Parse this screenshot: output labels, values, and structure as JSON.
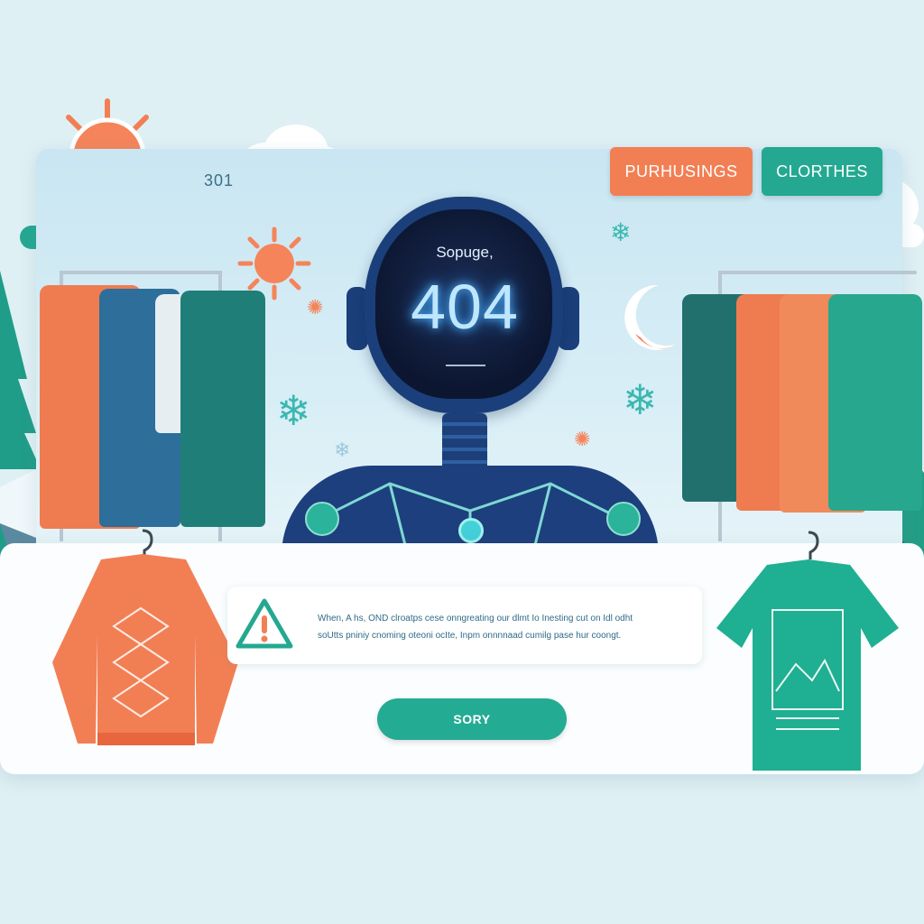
{
  "header": {
    "code_label": "301",
    "tabs": [
      {
        "label": "PURHUSINGS",
        "color": "#f27f54"
      },
      {
        "label": "CLORTHES",
        "color": "#24a891"
      }
    ]
  },
  "robot": {
    "screen_caption": "Sopuge,",
    "error_code": "404"
  },
  "alert": {
    "icon": "warning-icon",
    "line1": "When, A hs, OND clroatps cese onngreating our dlmt Io Inesting cut on Idl odht",
    "line2": "soUtts pniniy cnoming oteoni ocIte, Inpm onnnnaad cumilg pase hur coongt."
  },
  "action": {
    "button_label": "SORY"
  },
  "colors": {
    "accent_orange": "#f27f54",
    "accent_teal": "#24a891",
    "robot_navy": "#1a3f7a",
    "background": "#dff0f4"
  }
}
